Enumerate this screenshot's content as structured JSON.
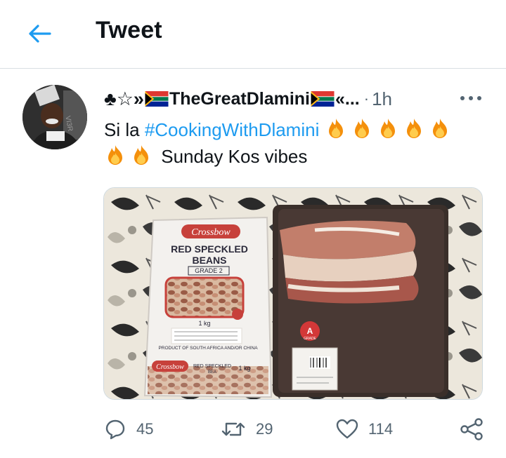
{
  "header": {
    "title": "Tweet",
    "back_icon": "arrow-left-icon",
    "accent": "#1d9bf0"
  },
  "tweet": {
    "display_name_prefix": "♣☆»",
    "display_name_main": "TheGreatDlamini",
    "display_name_suffix": "«...",
    "separator": "·",
    "time": "1h",
    "text_before": "Si la ",
    "hashtag": "#CookingWithDlamini",
    "text_after": "Sunday Kos vibes",
    "fire_count": 7,
    "media_alt": "Bag of red speckled beans and a tray of meat",
    "media_labels": {
      "brand": "Crossbow",
      "product_line1": "RED SPECKLED",
      "product_line2": "BEANS",
      "grade": "GRADE 2",
      "weight": "1 kg",
      "origin": "PRODUCT OF SOUTH AFRICA AND/OR CHINA",
      "bottom_product": "RED SPECKLED",
      "bottom_product2": "BEA",
      "bottom_weight": "1 kg",
      "tray_badge": "A",
      "tray_badge_sub": "GRADE"
    }
  },
  "actions": {
    "reply_count": "45",
    "retweet_count": "29",
    "like_count": "114"
  },
  "colors": {
    "text": "#0f1419",
    "muted": "#536471",
    "link": "#1d9bf0",
    "border": "#cfd9de"
  }
}
